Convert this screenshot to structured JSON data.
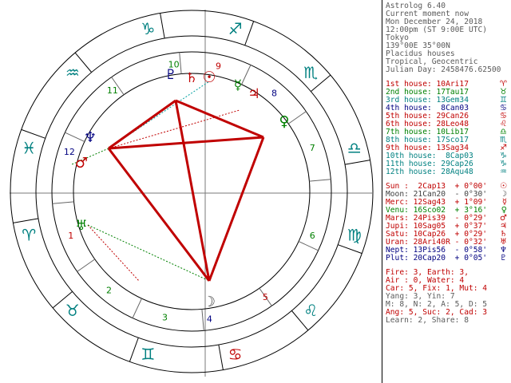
{
  "header": {
    "app": "Astrolog 6.40",
    "title": "Current moment now",
    "date": "Mon December 24, 2018",
    "time": "12:00pm (ST 9:00E UTC)",
    "place": "Tokyo",
    "coords": "139°00E 35°00N",
    "system": "Placidus houses",
    "zodiac": "Tropical, Geocentric",
    "julian": "Julian Day: 2458476.62500"
  },
  "houses": [
    {
      "text": "1st house: 10Ari17",
      "glyph": "♈",
      "color": "#c00000"
    },
    {
      "text": "2nd house: 17Tau17",
      "glyph": "♉",
      "color": "#008000"
    },
    {
      "text": "3rd house: 13Gem34",
      "glyph": "♊",
      "color": "#008080"
    },
    {
      "text": "4th house:  8Can03",
      "glyph": "♋",
      "color": "#000080"
    },
    {
      "text": "5th house: 29Can26",
      "glyph": "♋",
      "color": "#c00000"
    },
    {
      "text": "6th house: 28Leo48",
      "glyph": "♌",
      "color": "#c00000"
    },
    {
      "text": "7th house: 10Lib17",
      "glyph": "♎",
      "color": "#008000"
    },
    {
      "text": "8th house: 17Sco17",
      "glyph": "♏",
      "color": "#008080"
    },
    {
      "text": "9th house: 13Sag34",
      "glyph": "♐",
      "color": "#c00000"
    },
    {
      "text": "10th house:  8Cap03",
      "glyph": "♑",
      "color": "#008080"
    },
    {
      "text": "11th house: 29Cap26",
      "glyph": "♑",
      "color": "#008080"
    },
    {
      "text": "12th house: 28Aqu48",
      "glyph": "♒",
      "color": "#008080"
    }
  ],
  "planets": [
    {
      "text": "Sun :  2Cap13  + 0°00'",
      "glyph": "☉",
      "color": "#c00000"
    },
    {
      "text": "Moon: 21Can20  - 0°30'",
      "glyph": "☽",
      "color": "#404040"
    },
    {
      "text": "Merc: 12Sag43  + 1°09'",
      "glyph": "☿",
      "color": "#c00000"
    },
    {
      "text": "Venu: 16Sco02  + 3°16'",
      "glyph": "♀",
      "color": "#008000"
    },
    {
      "text": "Mars: 24Pis39  - 0°29'",
      "glyph": "♂",
      "color": "#c00000"
    },
    {
      "text": "Jupi: 10Sag05  + 0°37'",
      "glyph": "♃",
      "color": "#c00000"
    },
    {
      "text": "Satu: 10Cap26  + 0°29'",
      "glyph": "♄",
      "color": "#c00000"
    },
    {
      "text": "Uran: 28Ari40R - 0°32'",
      "glyph": "♅",
      "color": "#c00000"
    },
    {
      "text": "Nept: 13Pis56  - 0°58'",
      "glyph": "♆",
      "color": "#000080"
    },
    {
      "text": "Plut: 20Cap20  + 0°05'",
      "glyph": "♇",
      "color": "#000080"
    }
  ],
  "summary": {
    "elements": "Fire: 3, Earth: 3,",
    "elements2": "Air : 0, Water: 4",
    "modes": "Car: 5, Fix: 1, Mut: 4",
    "yang": "Yang: 3, Yin: 7",
    "hemis": "M: 8, N: 2, A: 5, D: 5",
    "quadrants": "Ang: 5, Suc: 2, Cad: 3",
    "learn": "Learn: 2, Share: 8"
  },
  "wheel": {
    "signs": [
      "♈",
      "♉",
      "♊",
      "♋",
      "♌",
      "♍",
      "♎",
      "♏",
      "♐",
      "♑",
      "♒",
      "♓"
    ],
    "sign_colors": [
      "#008080",
      "#008080",
      "#008080",
      "#c00000",
      "#008080",
      "#008080",
      "#008080",
      "#008080",
      "#008080",
      "#008080",
      "#008080",
      "#008080"
    ],
    "house_numbers": [
      "1",
      "2",
      "3",
      "4",
      "5",
      "6",
      "7",
      "8",
      "9",
      "10",
      "11",
      "12"
    ],
    "house_number_colors": [
      "#c00000",
      "#008000",
      "#008000",
      "#000080",
      "#c00000",
      "#008000",
      "#008000",
      "#000080",
      "#c00000",
      "#008000",
      "#008000",
      "#000080"
    ],
    "planet_glyphs": [
      {
        "glyph": "♀",
        "color": "#008000"
      },
      {
        "glyph": "☿",
        "color": "#008000"
      },
      {
        "glyph": "♃",
        "color": "#c00000"
      },
      {
        "glyph": "☉",
        "color": "#c00000"
      },
      {
        "glyph": "♄",
        "color": "#c00000"
      },
      {
        "glyph": "♇",
        "color": "#000080"
      },
      {
        "glyph": "♆",
        "color": "#000080"
      },
      {
        "glyph": "♂",
        "color": "#c00000"
      },
      {
        "glyph": "♅",
        "color": "#008000"
      },
      {
        "glyph": "☽",
        "color": "#404040"
      }
    ]
  }
}
